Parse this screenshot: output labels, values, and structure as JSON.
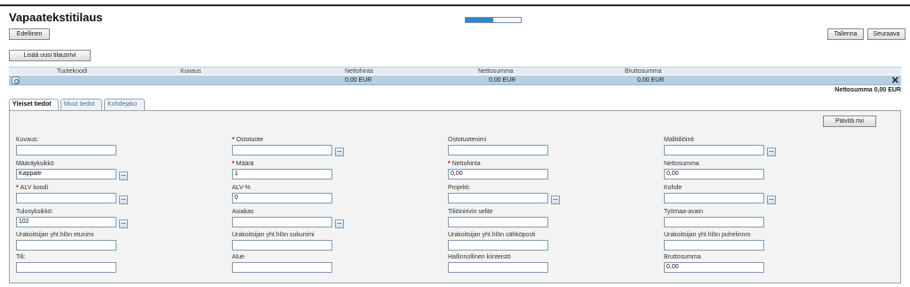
{
  "page": {
    "title": "Vapaatekstitilaus",
    "progress": 0.5
  },
  "toolbar": {
    "previous_label": "Edellinen",
    "save_label": "Tallenna",
    "next_label": "Seuraava",
    "add_row_label": "Lisää uusi tilausrivi"
  },
  "grid": {
    "columns": [
      "Tuotekoodi",
      "Kuvaus",
      "Nettohinta",
      "Nettosumma",
      "Bruttosumma"
    ],
    "row": {
      "nettohinta": "0,00 EUR",
      "nettosumma": "0,00 EUR",
      "bruttosumma": "0,00 EUR"
    },
    "total": "Nettosumma 0,00 EUR"
  },
  "tabs": [
    "Yleiset tiedot",
    "Muut tiedot",
    "Kohdejako"
  ],
  "panel": {
    "update_row_label": "Päivitä rivi"
  },
  "fields": {
    "kuvaus": {
      "label": "Kuvaus:",
      "value": ""
    },
    "ostotuote": {
      "label": "Ostotuote",
      "value": ""
    },
    "ostotuotenimi": {
      "label": "Ostotuotenimi",
      "value": ""
    },
    "mallitiliointi": {
      "label": "Mallitiliöinti",
      "value": ""
    },
    "maarayksikko": {
      "label": "Määräyksikkö",
      "value": "Kappale"
    },
    "maara": {
      "label": "Määrä",
      "value": "1"
    },
    "nettohinta": {
      "label": "Nettohinta",
      "value": "0,00"
    },
    "nettosumma": {
      "label": "Nettosumma",
      "value": "0,00"
    },
    "alv_koodi": {
      "label": "ALV koodi",
      "value": ""
    },
    "alv_prosentti": {
      "label": "ALV-%",
      "value": "0"
    },
    "projekti": {
      "label": "Projekti:",
      "value": ""
    },
    "kohde": {
      "label": "Kohde",
      "value": ""
    },
    "tulosyksikko": {
      "label": "Tulosyksikkö:",
      "value": "102"
    },
    "asiakas": {
      "label": "Asiakas",
      "value": ""
    },
    "tiliointirivin_selite": {
      "label": "Tiliöinirivin selite",
      "value": ""
    },
    "tyomaa_avain": {
      "label": "Työmaa-avain",
      "value": ""
    },
    "etunimi": {
      "label": "Urakoitsijan yht.hlön etunimi",
      "value": ""
    },
    "sukunimi": {
      "label": "Urakoitsijan yht.hlön sukunimi",
      "value": ""
    },
    "sahkoposti": {
      "label": "Urakoitsijan yht.hlön sähköposti",
      "value": ""
    },
    "puhelinnro": {
      "label": "Urakoitsijan yht.hlön puhelinnro",
      "value": ""
    },
    "tili": {
      "label": "Tili:",
      "value": ""
    },
    "alue": {
      "label": "Alue",
      "value": ""
    },
    "hallinnollinen_kiinteisto": {
      "label": "Hallinnollinen kiinteistö",
      "value": ""
    },
    "bruttosumma": {
      "label": "Bruttosumma",
      "value": "0,00"
    }
  }
}
